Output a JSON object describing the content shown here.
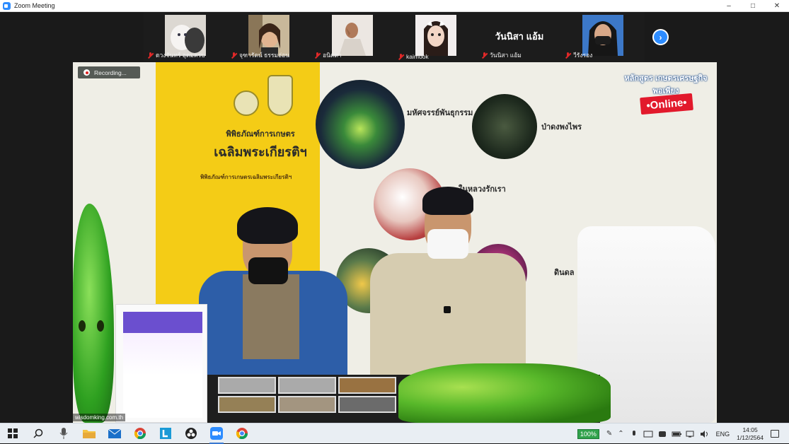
{
  "window": {
    "title": "Zoom Meeting",
    "controls": {
      "minimize": "–",
      "maximize": "□",
      "close": "✕"
    }
  },
  "participants": [
    {
      "name": "ดวงจันทร์ อุดมครบ",
      "muted": true,
      "thumb": "cat-photo"
    },
    {
      "name": "จุฑารัตน์ ธรรมอ่อน",
      "muted": true,
      "thumb": "person-photo"
    },
    {
      "name": "อนิตตา",
      "muted": true,
      "thumb": "hand-photo"
    },
    {
      "name": "kaimook",
      "muted": true,
      "thumb": "person-photo"
    },
    {
      "name": "วันนิสา แอ้ม",
      "muted": true,
      "thumb": "name-only",
      "big_name": "วันนิสา แอ้ม"
    },
    {
      "name": "วีรังรอง",
      "muted": true,
      "thumb": "person-photo"
    }
  ],
  "next_page_icon": "›",
  "video": {
    "recording_label": "Recording...",
    "museum_title_l1": "พิพิธภัณฑ์การเกษตร",
    "museum_title_l2": "เฉลิมพระเกียรติฯ",
    "para_head": "พิพิธภัณฑ์การเกษตรเฉลิมพระเกียรติฯ",
    "label_1": "มหัศจรรย์พันธุกรรม",
    "label_2": "ป่าดงพงไพร",
    "label_3": "ในหลวงรักเรา",
    "label_4": "ดินดล",
    "course_title": "หลักสูตร เกษตรเศรษฐกิจพอเพียง",
    "online_badge": "•Online•",
    "watermark": "wisdomking.com.th"
  },
  "taskbar": {
    "items": [
      {
        "name": "windows-start-icon",
        "active": false
      },
      {
        "name": "search-icon",
        "active": false
      },
      {
        "name": "microphone-icon",
        "active": false
      },
      {
        "name": "file-explorer-icon",
        "active": false
      },
      {
        "name": "mail-icon",
        "active": false
      },
      {
        "name": "chrome-icon",
        "active": false
      },
      {
        "name": "l-app-icon",
        "active": false
      },
      {
        "name": "obs-icon",
        "active": false
      },
      {
        "name": "zoom-icon",
        "active": true
      },
      {
        "name": "chrome-2-icon",
        "active": false
      }
    ],
    "battery": "100%",
    "language": "ENG",
    "time": "14:05",
    "date": "1/12/2564"
  }
}
